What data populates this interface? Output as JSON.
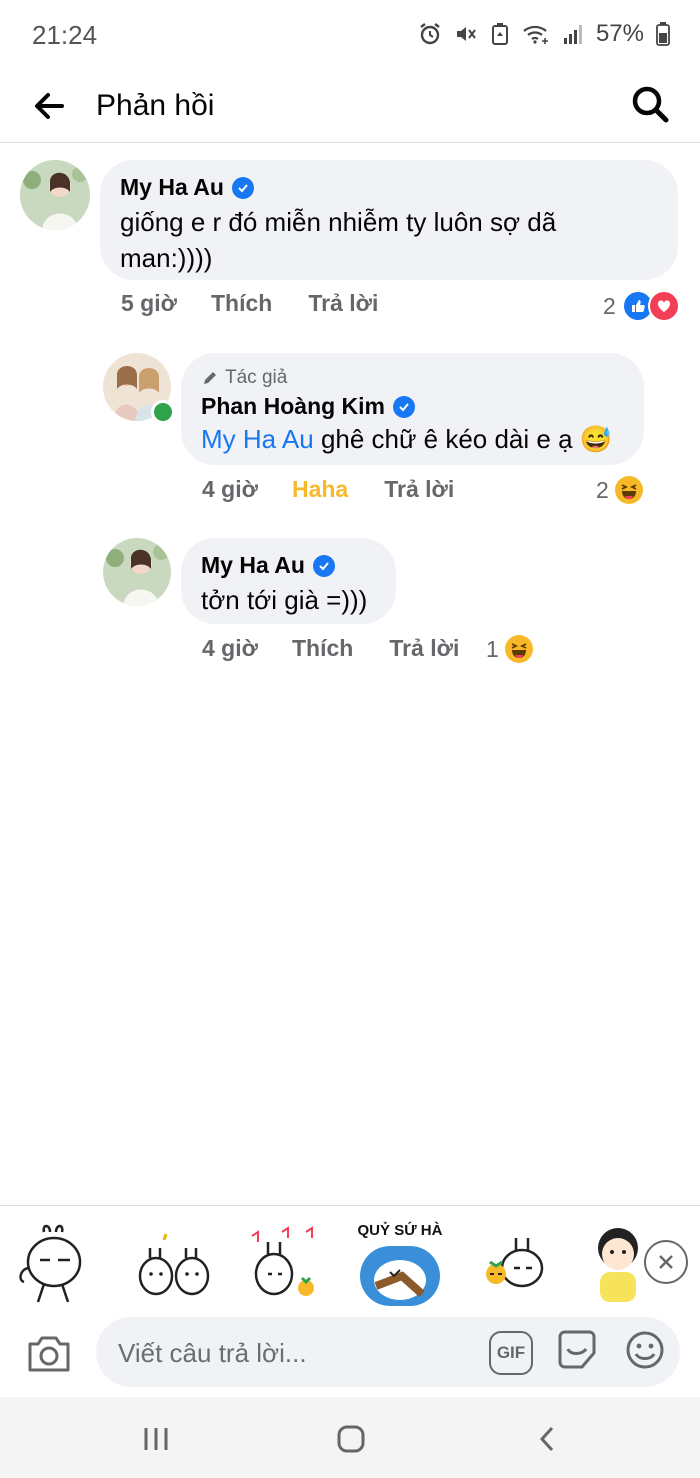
{
  "status_bar": {
    "time": "21:24",
    "battery": "57%",
    "icons": [
      "alarm-icon",
      "mute-icon",
      "battery-saver-icon",
      "wifi-icon",
      "signal-icon",
      "battery-icon"
    ]
  },
  "header": {
    "title": "Phản hồi",
    "back_icon": "arrow-left-icon",
    "search_icon": "search-icon"
  },
  "comments": [
    {
      "author": "My Ha Au",
      "verified": true,
      "text": "giống e r đó miễn nhiễm ty luôn sợ dã man:))))",
      "time": "5 giờ",
      "like_label": "Thích",
      "reply_label": "Trả lời",
      "reaction_count": "2",
      "reactions": [
        "like",
        "love"
      ]
    },
    {
      "author_tag": "Tác giả",
      "author": "Phan Hoàng Kim",
      "verified": true,
      "online": true,
      "mention": "My Ha Au",
      "text": "ghê chữ ê kéo dài e ạ 😅",
      "time": "4 giờ",
      "like_label": "Haha",
      "reply_label": "Trả lời",
      "reaction_count": "2",
      "reactions": [
        "haha"
      ]
    },
    {
      "author": "My Ha Au",
      "verified": true,
      "text": "tởn tới già =)))",
      "time": "4 giờ",
      "like_label": "Thích",
      "reply_label": "Trả lời",
      "reaction_count": "1",
      "reactions": [
        "haha"
      ]
    }
  ],
  "sticker_bar": {
    "stickers": [
      "rabbit-sticker",
      "two-rabbits-sticker",
      "music-rabbit-sticker",
      "quy-su-ha-sticker",
      "rabbit-carrot-sticker",
      "girl-sticker"
    ],
    "quy_su_ha_text": "QUỶ SỨ HÀ"
  },
  "composer": {
    "placeholder": "Viết câu trả lời...",
    "gif_label": "GIF"
  },
  "colors": {
    "accent": "#1877f2",
    "haha": "#f7b928",
    "love": "#f33e58",
    "bubble": "#f0f2f5",
    "online": "#31a24c"
  }
}
